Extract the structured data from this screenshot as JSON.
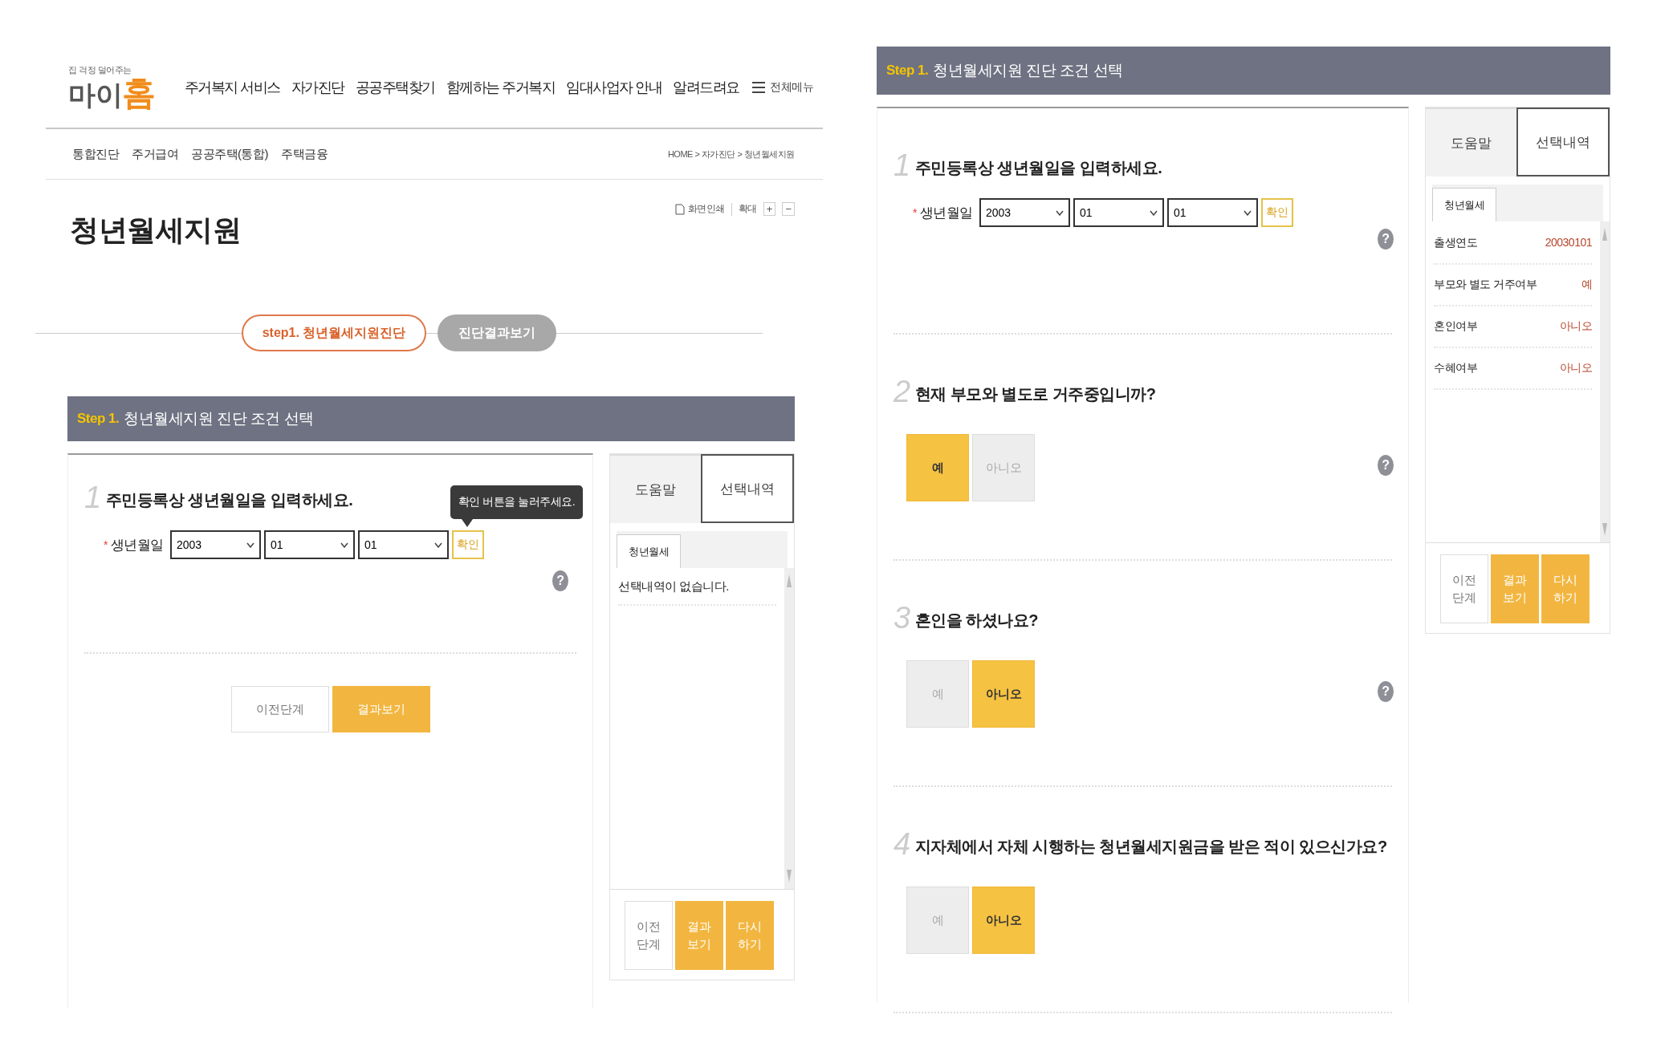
{
  "left": {
    "logo": {
      "tagline": "집 걱정 덜어주는",
      "name": "마이",
      "accent": "홈"
    },
    "nav": [
      "주거복지 서비스",
      "자가진단",
      "공공주택찾기",
      "함께하는 주거복지",
      "임대사업자 안내",
      "알려드려요"
    ],
    "all_menu": "전체메뉴",
    "subnav": [
      "통합진단",
      "주거급여",
      "공공주택(통합)",
      "주택금융"
    ],
    "breadcrumb": "HOME > 자가진단 > 청년월세지원",
    "tools": {
      "print": "화면인쇄",
      "zoom": "확대",
      "zoom_in": "+",
      "zoom_out": "−"
    },
    "page_title": "청년월세지원",
    "steps": [
      {
        "label": "step1. 청년월세지원진단",
        "selected": true
      },
      {
        "label": "진단결과보기",
        "selected": false
      }
    ],
    "section": {
      "step": "Step 1.",
      "title": "청년월세지원 진단 조건 선택"
    },
    "questions": [
      {
        "number": "1",
        "text": "주민등록상 생년월일을 입력하세요.",
        "kind": "date",
        "required": "*",
        "label": "생년월일",
        "selects": [
          "2003",
          "01",
          "01"
        ],
        "confirm": "확인",
        "tooltip": "확인 버튼을 눌러주세요.",
        "help": "?"
      }
    ],
    "buttons": [
      {
        "label": "이전단계",
        "kind": "secondary"
      },
      {
        "label": "결과보기",
        "kind": "primary"
      }
    ],
    "side": {
      "tabs": [
        {
          "label": "도움말",
          "selected": false
        },
        {
          "label": "선택내역",
          "selected": true
        }
      ],
      "subtab": "청년월세",
      "empty": "선택내역이 없습니다.",
      "buttons": [
        {
          "label": "이전단계",
          "kind": "secondary"
        },
        {
          "label": "결과보기",
          "kind": "primary"
        },
        {
          "label": "다시하기",
          "kind": "primary"
        }
      ]
    }
  },
  "right": {
    "section": {
      "step": "Step 1.",
      "title": "청년월세지원 진단 조건 선택"
    },
    "questions": [
      {
        "number": "1",
        "text": "주민등록상 생년월일을 입력하세요.",
        "kind": "date",
        "required": "*",
        "label": "생년월일",
        "selects": [
          "2003",
          "01",
          "01"
        ],
        "confirm": "확인",
        "help": "?"
      },
      {
        "number": "2",
        "text": "현재 부모와 별도로 거주중입니까?",
        "kind": "yesno",
        "options": [
          {
            "label": "예",
            "selected": true
          },
          {
            "label": "아니오",
            "selected": false
          }
        ],
        "help": "?"
      },
      {
        "number": "3",
        "text": "혼인을 하셨나요?",
        "kind": "yesno",
        "options": [
          {
            "label": "예",
            "selected": false
          },
          {
            "label": "아니오",
            "selected": true
          }
        ],
        "help": "?"
      },
      {
        "number": "4",
        "text": "지자체에서 자체 시행하는 청년월세지원금을 받은 적이 있으신가요?",
        "kind": "yesno",
        "options": [
          {
            "label": "예",
            "selected": false
          },
          {
            "label": "아니오",
            "selected": true
          }
        ]
      }
    ],
    "side": {
      "tabs": [
        {
          "label": "도움말",
          "selected": false
        },
        {
          "label": "선택내역",
          "selected": true
        }
      ],
      "subtab": "청년월세",
      "items": [
        {
          "label": "출생연도",
          "value": "20030101"
        },
        {
          "label": "부모와 별도 거주여부",
          "value": "예"
        },
        {
          "label": "혼인여부",
          "value": "아니오"
        },
        {
          "label": "수혜여부",
          "value": "아니오"
        }
      ],
      "buttons": [
        {
          "label": "이전단계",
          "kind": "secondary"
        },
        {
          "label": "결과보기",
          "kind": "primary"
        },
        {
          "label": "다시하기",
          "kind": "primary"
        }
      ]
    }
  }
}
